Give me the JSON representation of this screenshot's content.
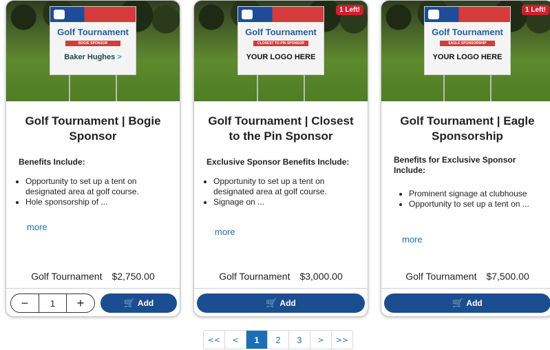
{
  "products": [
    {
      "badge": "",
      "sign": {
        "title": "Golf Tournament",
        "strip": "BOGIE SPONSOR",
        "logo_a": "Baker Hughes",
        "logo_b": " >"
      },
      "title": "Golf Tournament | Bogie Sponsor",
      "benefits_heading": "Benefits Include:",
      "benefits": [
        "Opportunity to set up a tent on designated area at golf course.",
        "Hole sponsorship of ..."
      ],
      "more": "more",
      "category": "Golf Tournament",
      "price": "$2,750.00",
      "qty": {
        "minus": "−",
        "value": "1",
        "plus": "+"
      },
      "add_label": "Add"
    },
    {
      "badge": "1 Left!",
      "sign": {
        "title": "Golf Tournament",
        "strip": "CLOSEST TO PIN SPONSOR",
        "logo_a": "YOUR LOGO HERE"
      },
      "title": "Golf Tournament | Closest to the Pin Sponsor",
      "benefits_heading": "Exclusive Sponsor Benefits Include:",
      "benefits": [
        "Opportunity to set up a tent on designated area at golf course.",
        "Signage on ..."
      ],
      "more": "more",
      "category": "Golf Tournament",
      "price": "$3,000.00",
      "add_label": "Add"
    },
    {
      "badge": "1 Left!",
      "sign": {
        "title": "Golf Tournament",
        "strip": "EAGLE SPONSORSHIP",
        "logo_a": "YOUR LOGO HERE"
      },
      "title": "Golf Tournament | Eagle Sponsorship",
      "benefits_heading": "Benefits for Exclusive Sponsor Include:",
      "benefits": [
        "Prominent signage at clubhouse",
        "Opportunity to set up a tent on ..."
      ],
      "more": "more",
      "category": "Golf Tournament",
      "price": "$7,500.00",
      "add_label": "Add"
    }
  ],
  "pager": {
    "first": "<<",
    "prev": "<",
    "pages": [
      "1",
      "2",
      "3"
    ],
    "active_page": "1",
    "next": ">",
    "last": ">>"
  },
  "colors": {
    "accent": "#1a4e91",
    "link": "#1a6fb5",
    "badge": "#d11f2e"
  },
  "icons": {
    "cart": "cart-icon"
  }
}
